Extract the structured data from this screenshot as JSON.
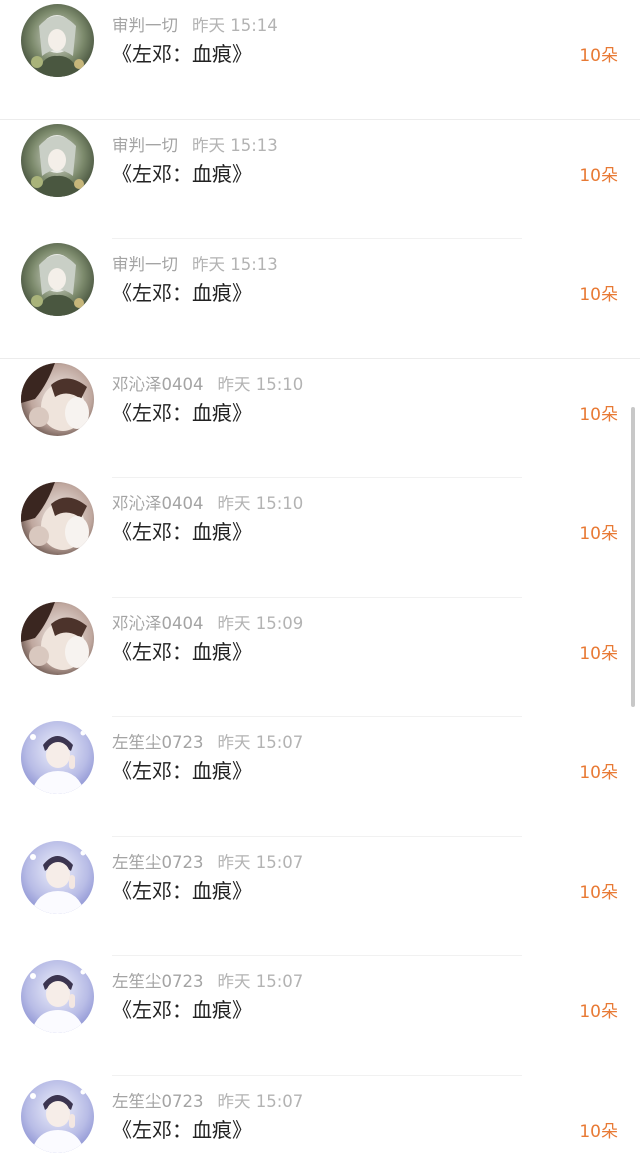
{
  "messages": [
    {
      "user": "审判一切",
      "time": "昨天 15:14",
      "title": "《左邓：血痕》",
      "amount": "10朵",
      "avatar": "anime-avatar"
    },
    {
      "user": "审判一切",
      "time": "昨天 15:13",
      "title": "《左邓：血痕》",
      "amount": "10朵",
      "avatar": "anime-avatar"
    },
    {
      "user": "审判一切",
      "time": "昨天 15:13",
      "title": "《左邓：血痕》",
      "amount": "10朵",
      "avatar": "anime-avatar"
    },
    {
      "user": "邓沁泽0404",
      "time": "昨天 15:10",
      "title": "《左邓：血痕》",
      "amount": "10朵",
      "avatar": "portrait-avatar"
    },
    {
      "user": "邓沁泽0404",
      "time": "昨天 15:10",
      "title": "《左邓：血痕》",
      "amount": "10朵",
      "avatar": "portrait-avatar"
    },
    {
      "user": "邓沁泽0404",
      "time": "昨天 15:09",
      "title": "《左邓：血痕》",
      "amount": "10朵",
      "avatar": "portrait-avatar"
    },
    {
      "user": "左笙尘0723",
      "time": "昨天 15:07",
      "title": "《左邓：血痕》",
      "amount": "10朵",
      "avatar": "stage-avatar"
    },
    {
      "user": "左笙尘0723",
      "time": "昨天 15:07",
      "title": "《左邓：血痕》",
      "amount": "10朵",
      "avatar": "stage-avatar"
    },
    {
      "user": "左笙尘0723",
      "time": "昨天 15:07",
      "title": "《左邓：血痕》",
      "amount": "10朵",
      "avatar": "stage-avatar"
    },
    {
      "user": "左笙尘0723",
      "time": "昨天 15:07",
      "title": "《左邓：血痕》",
      "amount": "10朵",
      "avatar": "stage-avatar"
    }
  ],
  "colors": {
    "amount": "#e87a35",
    "meta": "#a4a4a4",
    "title": "#222222"
  }
}
